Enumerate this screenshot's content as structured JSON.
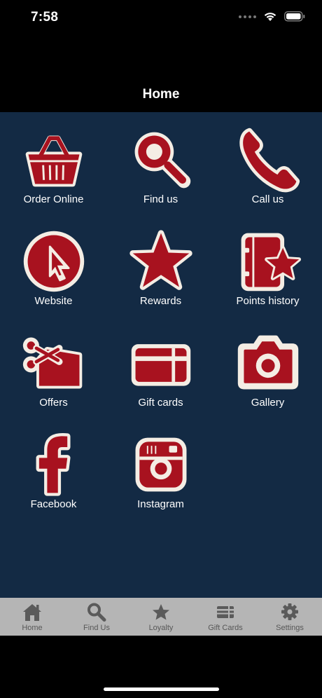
{
  "status_bar": {
    "time": "7:58"
  },
  "nav": {
    "title": "Home"
  },
  "tiles": [
    {
      "label": "Order Online",
      "icon": "basket-icon"
    },
    {
      "label": "Find us",
      "icon": "magnifier-icon"
    },
    {
      "label": "Call us",
      "icon": "phone-icon"
    },
    {
      "label": "Website",
      "icon": "cursor-icon"
    },
    {
      "label": "Rewards",
      "icon": "star-icon"
    },
    {
      "label": "Points history",
      "icon": "booklet-star-icon"
    },
    {
      "label": "Offers",
      "icon": "scissors-coupon-icon"
    },
    {
      "label": "Gift cards",
      "icon": "gift-card-icon"
    },
    {
      "label": "Gallery",
      "icon": "camera-icon"
    },
    {
      "label": "Facebook",
      "icon": "facebook-icon"
    },
    {
      "label": "Instagram",
      "icon": "instagram-icon"
    }
  ],
  "tab_bar": {
    "tabs": [
      {
        "label": "Home",
        "icon": "home-icon"
      },
      {
        "label": "Find Us",
        "icon": "search-icon"
      },
      {
        "label": "Loyalty",
        "icon": "star-icon"
      },
      {
        "label": "Gift Cards",
        "icon": "cards-icon"
      },
      {
        "label": "Settings",
        "icon": "gear-icon"
      }
    ]
  },
  "colors": {
    "background": "#132a44",
    "icon_red": "#a8121f",
    "icon_border": "#f4ede4",
    "tab_bar": "#b5b5b5",
    "tab_icon": "#5a5a5a"
  }
}
